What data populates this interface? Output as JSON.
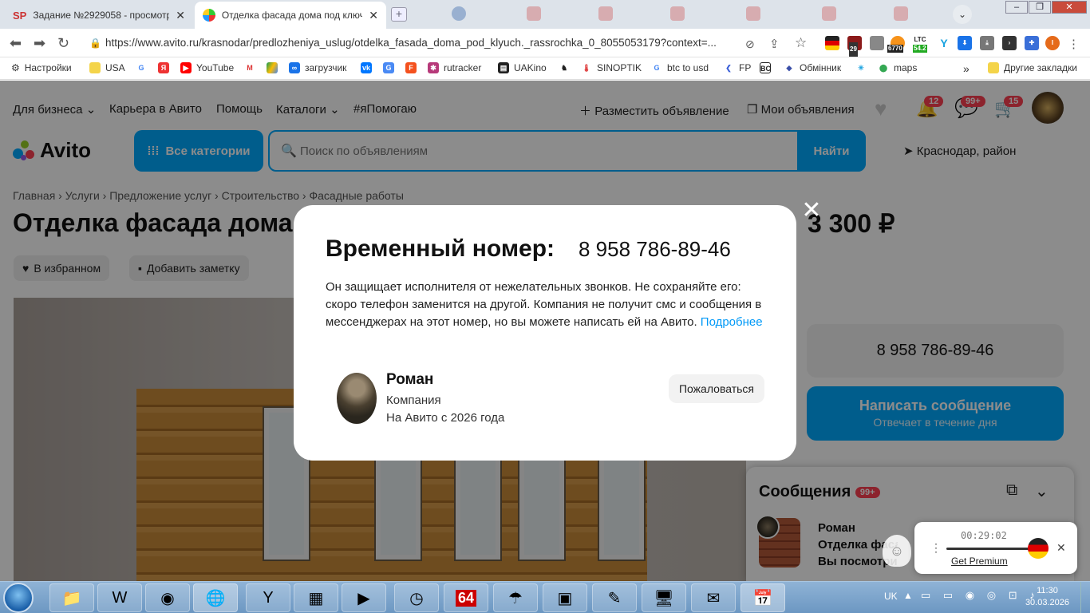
{
  "browser": {
    "tabs": [
      {
        "title": "Задание №2929058 - просмотр з",
        "favicon": "SP"
      },
      {
        "title": "Отделка фасада дома под ключ. Р",
        "favicon": "avito-icon"
      }
    ],
    "url": "https://www.avito.ru/krasnodar/predlozheniya_uslug/otdelka_fasada_doma_pod_klyuch._rassrochka_0_8055053179?context=...",
    "ext_badges": {
      "b1": "29",
      "ltc_label": "LTC",
      "b2": "6770",
      "b3": "54.2"
    },
    "bookmarks": [
      {
        "label": "Настройки"
      },
      {
        "label": "USA"
      },
      {
        "label": ""
      },
      {
        "label": ""
      },
      {
        "label": "YouTube"
      },
      {
        "label": ""
      },
      {
        "label": ""
      },
      {
        "label": "загрузчик"
      },
      {
        "label": ""
      },
      {
        "label": ""
      },
      {
        "label": ""
      },
      {
        "label": "rutracker"
      },
      {
        "label": "UAKino"
      },
      {
        "label": ""
      },
      {
        "label": "SINOPTIK"
      },
      {
        "label": "btc to usd"
      },
      {
        "label": "FP"
      },
      {
        "label": ""
      },
      {
        "label": "Обмінник"
      },
      {
        "label": ""
      },
      {
        "label": "maps"
      }
    ],
    "bookmarks_more": "»",
    "other_bookmarks": "Другие закладки"
  },
  "site": {
    "topnav": [
      "Для бизнеса",
      "Карьера в Авито",
      "Помощь",
      "Каталоги",
      "#яПомогаю"
    ],
    "post_ad": "Разместить объявление",
    "my_ads": "Мои объявления",
    "badges": {
      "notifications": "12",
      "messages": "99+",
      "cart": "15"
    },
    "logo": "Avito",
    "all_categories": "Все категории",
    "search_placeholder": "Поиск по объявлениям",
    "search_button": "Найти",
    "location": "Краснодар, район"
  },
  "listing": {
    "breadcrumbs": "Главная › Услуги › Предложение услуг › Строительство › Фасадные работы",
    "title": "Отделка фасада дома",
    "price": "3 300 ₽",
    "favorite": "В избранном",
    "note": "Добавить заметку",
    "phone": "8 958 786-89-46",
    "write_message": "Написать сообщение",
    "response_time": "Отвечает в течение дня"
  },
  "modal": {
    "title": "Временный номер:",
    "number": "8 958 786-89-46",
    "text": "Он защищает исполнителя от нежелательных звонков. Не сохраняйте его: скоро телефон заменится на другой. Компания не получит смс и сообщения в мессенджерах на этот номер, но вы можете написать ей на Авито.",
    "more_link": "Подробнее",
    "seller_name": "Роман",
    "seller_type": "Компания",
    "seller_since": "На Авито с 2026 года",
    "report": "Пожаловаться"
  },
  "messages": {
    "title": "Сообщения",
    "badge": "99+",
    "item_name": "Роман",
    "item_line1": "Отделка фаса",
    "item_line2": "Вы посмотри"
  },
  "widget": {
    "time": "00:29:02",
    "premium": "Get Premium"
  },
  "taskbar": {
    "lang": "UK",
    "time": "11:30",
    "date": "30.03.2026",
    "tile_64": "64"
  },
  "colors": {
    "accent": "#00aaff",
    "badge": "#ff4053",
    "link": "#0099f7"
  }
}
